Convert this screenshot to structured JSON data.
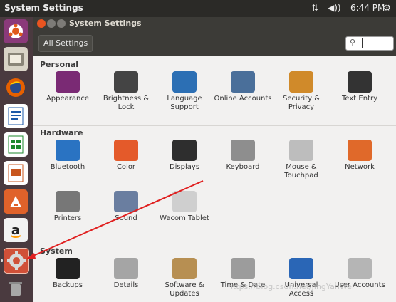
{
  "topbar": {
    "title": "System Settings",
    "time": "6:44 PM",
    "network_icon": "network-arrows-icon",
    "sound_icon": "volume-icon",
    "gear_icon": "gear-icon"
  },
  "window": {
    "title": "System Settings"
  },
  "toolbar": {
    "all_settings": "All Settings"
  },
  "sections": {
    "personal": "Personal",
    "hardware": "Hardware",
    "system": "System"
  },
  "personal_items": [
    {
      "label": "Appearance",
      "icon": "appearance-icon",
      "color": "#7a2a74"
    },
    {
      "label": "Brightness & Lock",
      "icon": "lock-icon",
      "color": "#444444"
    },
    {
      "label": "Language Support",
      "icon": "language-icon",
      "color": "#2c6fb4"
    },
    {
      "label": "Online Accounts",
      "icon": "online-accounts-icon",
      "color": "#4a6f9a"
    },
    {
      "label": "Security & Privacy",
      "icon": "security-icon",
      "color": "#d08a2a"
    },
    {
      "label": "Text Entry",
      "icon": "keyboard-grid-icon",
      "color": "#333333"
    }
  ],
  "hardware_items": [
    {
      "label": "Bluetooth",
      "icon": "bluetooth-icon",
      "color": "#2a73c2"
    },
    {
      "label": "Color",
      "icon": "color-icon",
      "color": "#e45a2a"
    },
    {
      "label": "Displays",
      "icon": "display-icon",
      "color": "#2e2e2e"
    },
    {
      "label": "Keyboard",
      "icon": "keyboard-icon",
      "color": "#8e8e8e"
    },
    {
      "label": "Mouse & Touchpad",
      "icon": "mouse-icon",
      "color": "#bdbdbd"
    },
    {
      "label": "Network",
      "icon": "network-icon",
      "color": "#e0692a"
    },
    {
      "label": "Printers",
      "icon": "printer-icon",
      "color": "#777777"
    },
    {
      "label": "Sound",
      "icon": "sound-icon",
      "color": "#6a7ea0"
    },
    {
      "label": "Wacom Tablet",
      "icon": "wacom-icon",
      "color": "#cfcfcf"
    }
  ],
  "system_items": [
    {
      "label": "Backups",
      "icon": "backups-icon",
      "color": "#222222"
    },
    {
      "label": "Details",
      "icon": "details-icon",
      "color": "#a5a5a5"
    },
    {
      "label": "Software & Updates",
      "icon": "software-icon",
      "color": "#b78f52"
    },
    {
      "label": "Time & Date",
      "icon": "clock-icon",
      "color": "#9c9c9c"
    },
    {
      "label": "Universal Access",
      "icon": "universal-access-icon",
      "color": "#2a66b6"
    },
    {
      "label": "User Accounts",
      "icon": "users-icon",
      "color": "#b5b5b5"
    }
  ],
  "watermark": "https://blog.csdn.net/JingYanWei"
}
